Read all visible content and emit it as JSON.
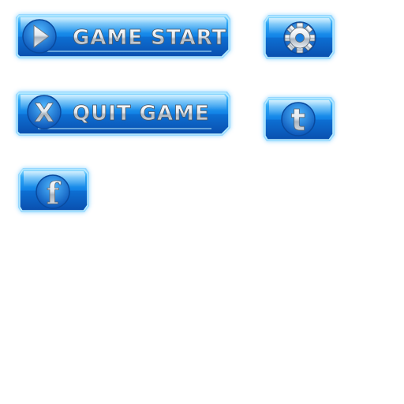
{
  "menu": {
    "game_start": {
      "label": "GAME START",
      "icon": "play-icon"
    },
    "quit_game": {
      "label": "QUIT GAME",
      "icon_glyph": "X",
      "icon": "x-icon"
    },
    "settings": {
      "icon": "gear-icon"
    },
    "twitter": {
      "icon_glyph": "t",
      "icon": "twitter-icon"
    },
    "facebook": {
      "icon_glyph": "f",
      "icon": "facebook-icon"
    }
  },
  "colors": {
    "button_blue": "#1a8ff0",
    "button_dark": "#0a4fae",
    "button_light": "#7fd0ff",
    "glow": "#3fb8ff",
    "label_silver": "#e8eef5",
    "icon_silver": "#c9d2dc"
  }
}
